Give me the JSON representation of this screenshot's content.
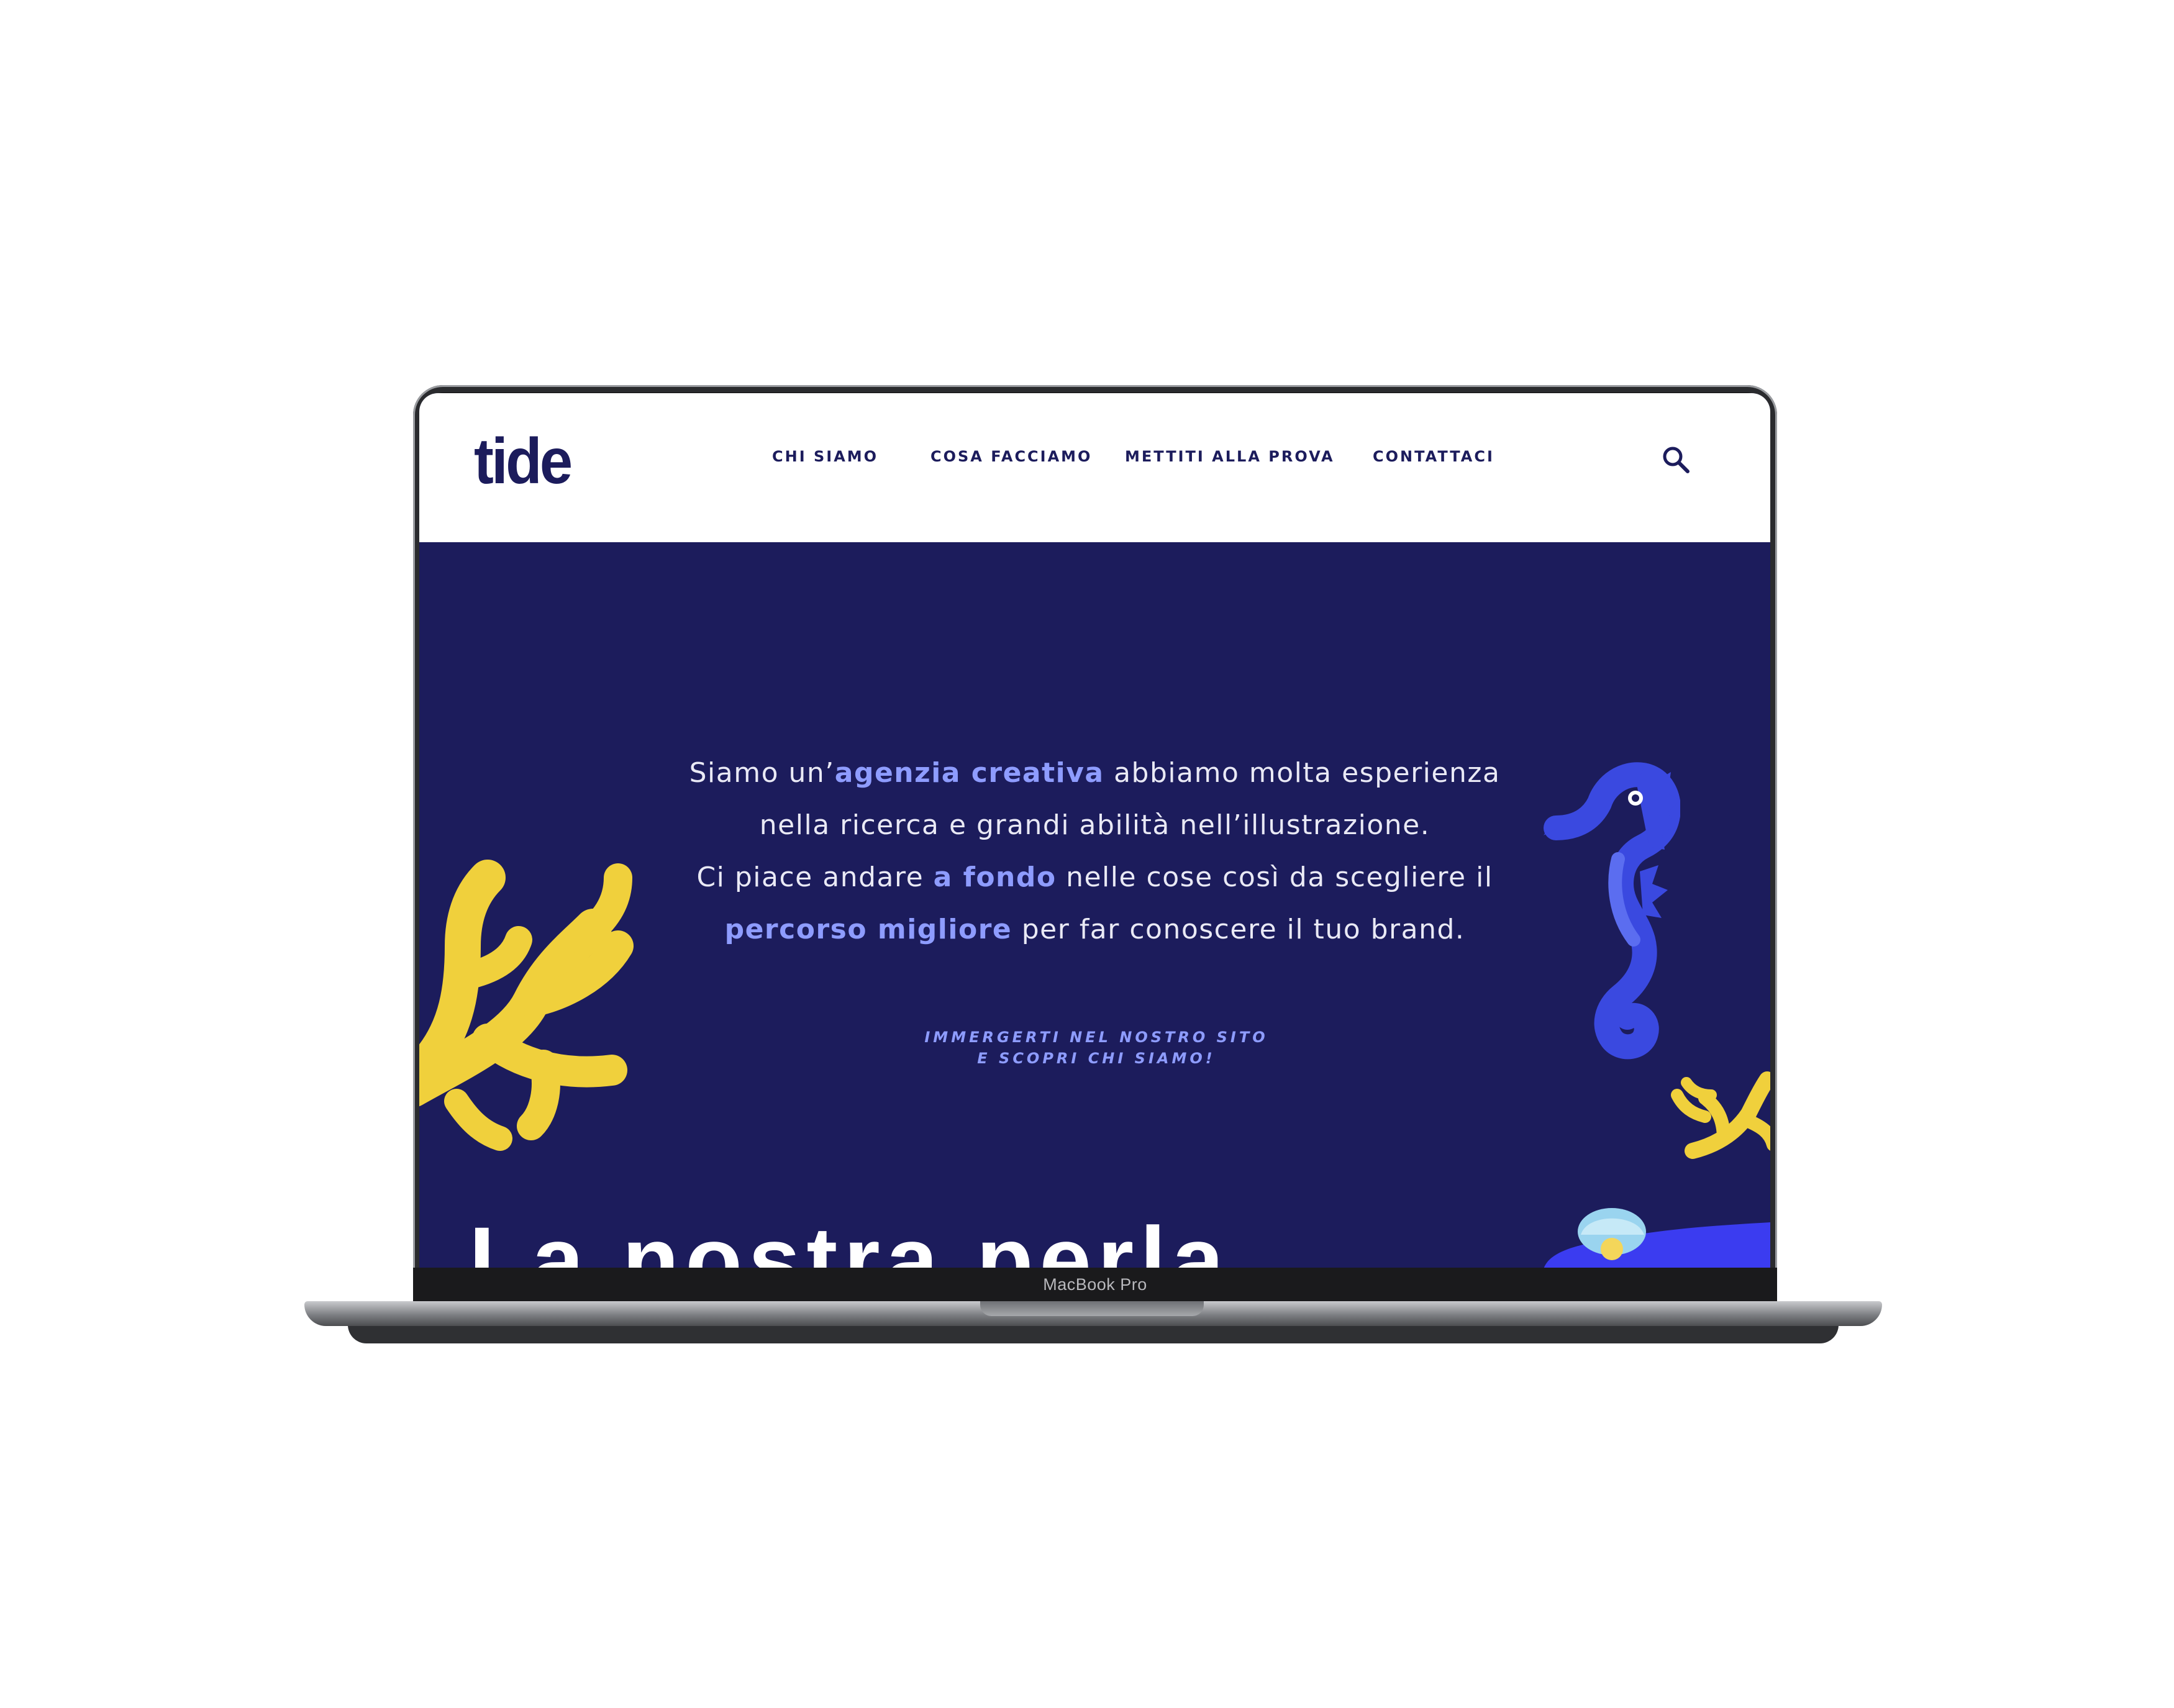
{
  "device": {
    "label": "MacBook Pro"
  },
  "site": {
    "logo_text": "tide",
    "nav": [
      {
        "label": "CHI SIAMO"
      },
      {
        "label": "COSA FACCIAMO"
      },
      {
        "label": "METTITI ALLA PROVA"
      },
      {
        "label": "CONTATTACI"
      }
    ],
    "hero": {
      "line1_a": "Siamo un’",
      "line1_hl": "agenzia creativa",
      "line1_b": " abbiamo molta esperienza",
      "line2": "nella ricerca e grandi abilità nell’illustrazione.",
      "line3_a": "Ci piace andare ",
      "line3_hl": "a fondo",
      "line3_b": " nelle cose così da scegliere il",
      "line4_hl": "percorso migliore",
      "line4_b": " per far conoscere il tuo brand."
    },
    "cta": {
      "line1": "IMMERGERTI NEL NOSTRO SITO",
      "line2": "E SCOPRI CHI SIAMO!"
    },
    "section_title": "La nostra perla"
  },
  "colors": {
    "navy": "#1c1c5c",
    "accent": "#8e9cff",
    "coral": "#f0d03c",
    "seahorse": "#3a49e0",
    "white": "#ffffff"
  },
  "icons": [
    "search-icon",
    "coral-icon",
    "seahorse-icon",
    "pearl-shell-icon"
  ]
}
